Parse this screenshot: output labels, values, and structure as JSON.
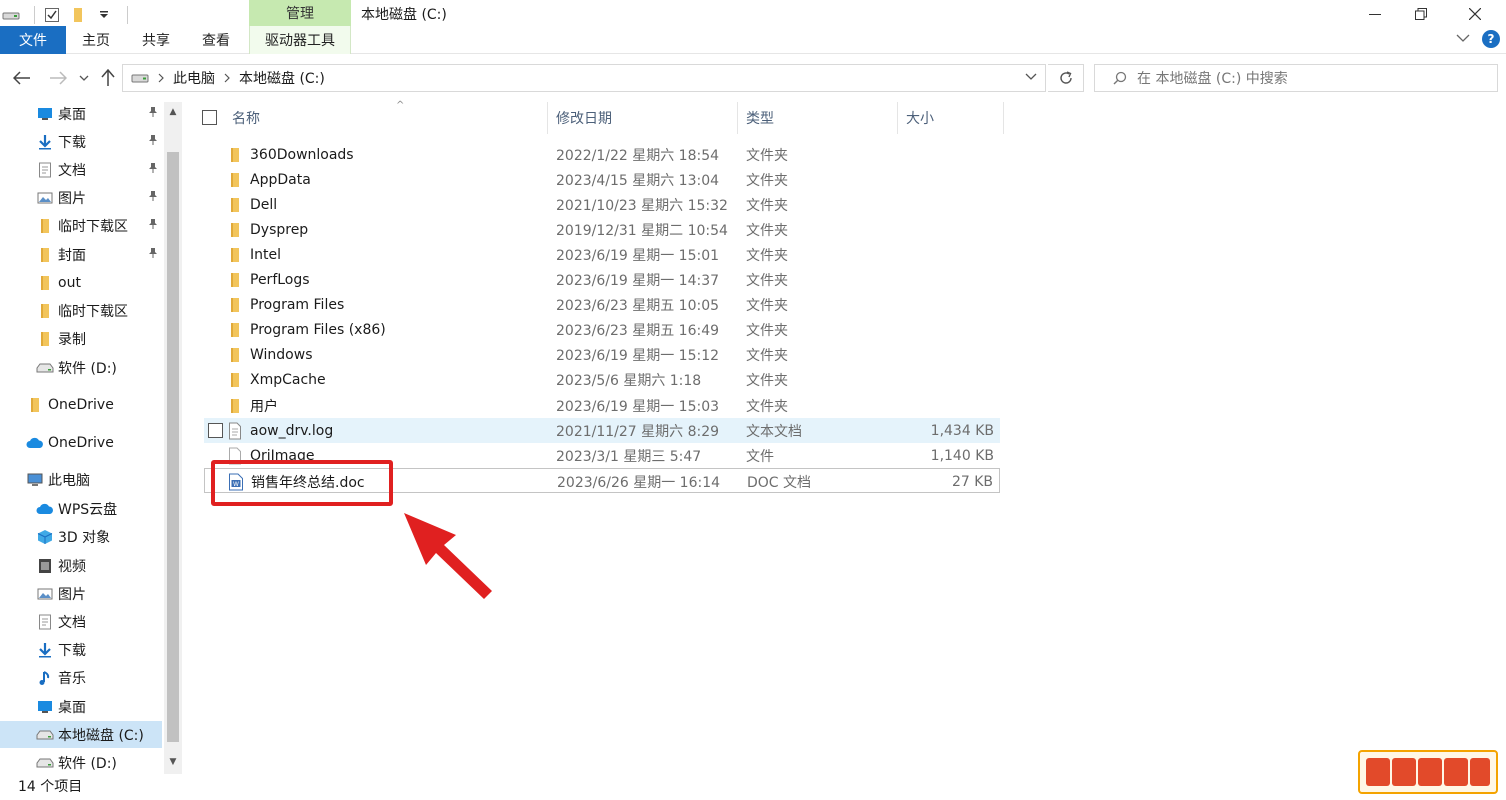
{
  "titlebar": {
    "manage_tab": "管理",
    "title": "本地磁盘 (C:)"
  },
  "ribbon": {
    "tabs": [
      "文件",
      "主页",
      "共享",
      "查看",
      "驱动器工具"
    ],
    "help": "?"
  },
  "address": {
    "crumbs": [
      "此电脑",
      "本地磁盘 (C:)"
    ],
    "search_placeholder": "在 本地磁盘 (C:) 中搜索"
  },
  "sidebar": {
    "items": [
      {
        "label": "桌面",
        "icon": "desktop-icon",
        "pinned": true
      },
      {
        "label": "下载",
        "icon": "download-icon",
        "pinned": true
      },
      {
        "label": "文档",
        "icon": "document-icon",
        "pinned": true
      },
      {
        "label": "图片",
        "icon": "picture-icon",
        "pinned": true
      },
      {
        "label": "临时下载区",
        "icon": "folder-icon",
        "pinned": true
      },
      {
        "label": "封面",
        "icon": "folder-icon",
        "pinned": true
      },
      {
        "label": "out",
        "icon": "folder-icon",
        "pinned": false
      },
      {
        "label": "临时下载区",
        "icon": "folder-icon",
        "pinned": false
      },
      {
        "label": "录制",
        "icon": "folder-icon",
        "pinned": false
      },
      {
        "label": "软件 (D:)",
        "icon": "drive-icon",
        "pinned": false
      },
      {
        "label": "OneDrive",
        "icon": "folder-icon",
        "pinned": false
      },
      {
        "label": "OneDrive",
        "icon": "cloud-icon",
        "pinned": false
      },
      {
        "label": "此电脑",
        "icon": "computer-icon",
        "pinned": false
      },
      {
        "label": "WPS云盘",
        "icon": "cloud-icon",
        "pinned": false
      },
      {
        "label": "3D 对象",
        "icon": "cube-icon",
        "pinned": false
      },
      {
        "label": "视频",
        "icon": "video-icon",
        "pinned": false
      },
      {
        "label": "图片",
        "icon": "picture-icon",
        "pinned": false
      },
      {
        "label": "文档",
        "icon": "document-icon",
        "pinned": false
      },
      {
        "label": "下载",
        "icon": "download-icon",
        "pinned": false
      },
      {
        "label": "音乐",
        "icon": "music-icon",
        "pinned": false
      },
      {
        "label": "桌面",
        "icon": "desktop-icon",
        "pinned": false
      },
      {
        "label": "本地磁盘 (C:)",
        "icon": "drive-icon",
        "pinned": false
      },
      {
        "label": "软件 (D:)",
        "icon": "drive-icon",
        "pinned": false
      }
    ],
    "selected_index": 21
  },
  "columns": {
    "name": "名称",
    "date": "修改日期",
    "type": "类型",
    "size": "大小"
  },
  "files": [
    {
      "name": "360Downloads",
      "date": "2022/1/22 星期六 18:54",
      "type": "文件夹",
      "size": "",
      "icon": "folder-icon"
    },
    {
      "name": "AppData",
      "date": "2023/4/15 星期六 13:04",
      "type": "文件夹",
      "size": "",
      "icon": "folder-icon"
    },
    {
      "name": "Dell",
      "date": "2021/10/23 星期六 15:32",
      "type": "文件夹",
      "size": "",
      "icon": "folder-icon"
    },
    {
      "name": "Dysprep",
      "date": "2019/12/31 星期二 10:54",
      "type": "文件夹",
      "size": "",
      "icon": "folder-icon"
    },
    {
      "name": "Intel",
      "date": "2023/6/19 星期一 15:01",
      "type": "文件夹",
      "size": "",
      "icon": "folder-icon"
    },
    {
      "name": "PerfLogs",
      "date": "2023/6/19 星期一 14:37",
      "type": "文件夹",
      "size": "",
      "icon": "folder-icon"
    },
    {
      "name": "Program Files",
      "date": "2023/6/23 星期五 10:05",
      "type": "文件夹",
      "size": "",
      "icon": "folder-icon"
    },
    {
      "name": "Program Files (x86)",
      "date": "2023/6/23 星期五 16:49",
      "type": "文件夹",
      "size": "",
      "icon": "folder-icon"
    },
    {
      "name": "Windows",
      "date": "2023/6/19 星期一 15:12",
      "type": "文件夹",
      "size": "",
      "icon": "folder-icon"
    },
    {
      "name": "XmpCache",
      "date": "2023/5/6 星期六 1:18",
      "type": "文件夹",
      "size": "",
      "icon": "folder-icon"
    },
    {
      "name": "用户",
      "date": "2023/6/19 星期一 15:03",
      "type": "文件夹",
      "size": "",
      "icon": "folder-icon"
    },
    {
      "name": "aow_drv.log",
      "date": "2021/11/27 星期六 8:29",
      "type": "文本文档",
      "size": "1,434 KB",
      "icon": "text-file-icon"
    },
    {
      "name": "OriImage",
      "date": "2023/3/1 星期三 5:47",
      "type": "文件",
      "size": "1,140 KB",
      "icon": "file-icon"
    },
    {
      "name": "销售年终总结.doc",
      "date": "2023/6/26 星期一 16:14",
      "type": "DOC 文档",
      "size": "27 KB",
      "icon": "word-doc-icon"
    }
  ],
  "hover_index": 11,
  "outlined_index": 13,
  "status": {
    "count": "14 个项目"
  },
  "watermark": {
    "text": "宝哥软件园"
  },
  "colors": {
    "accent": "#1a6ec2",
    "manage_tab": "#c6e9b0",
    "selection": "#cce4f7",
    "hover": "#e5f3fb",
    "annotation": "#e02020",
    "folder": "#f2c55c"
  }
}
